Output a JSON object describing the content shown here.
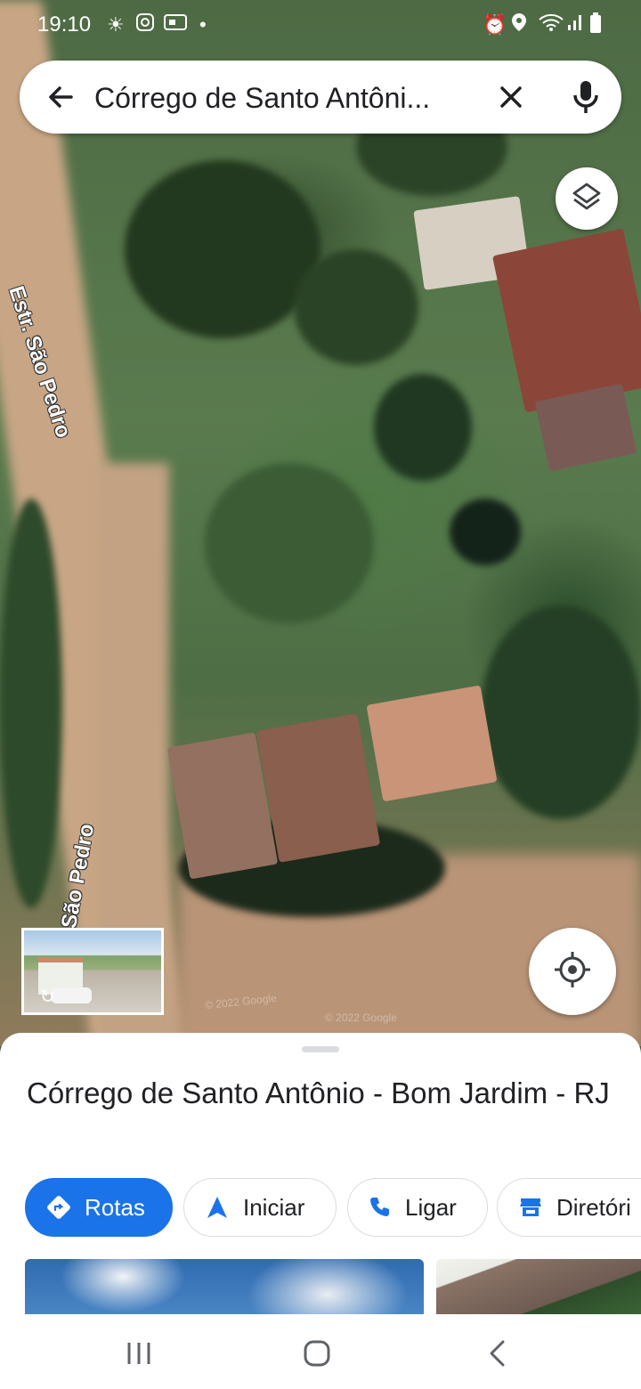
{
  "status_bar": {
    "time": "19:10"
  },
  "search": {
    "query": "Córrego de Santo Antôni..."
  },
  "map": {
    "road_label_1": "Estr. São Pedro",
    "road_label_2": "São Pedro",
    "watermark": "© 2022 Google"
  },
  "place": {
    "title": "Córrego de Santo Antônio - Bom Jardim - RJ"
  },
  "actions": [
    {
      "label": "Rotas",
      "icon": "directions-icon"
    },
    {
      "label": "Iniciar",
      "icon": "navigation-icon"
    },
    {
      "label": "Ligar",
      "icon": "phone-icon"
    },
    {
      "label": "Diretóri",
      "icon": "store-icon"
    }
  ],
  "colors": {
    "accent": "#1a73e8",
    "text": "#202124"
  }
}
